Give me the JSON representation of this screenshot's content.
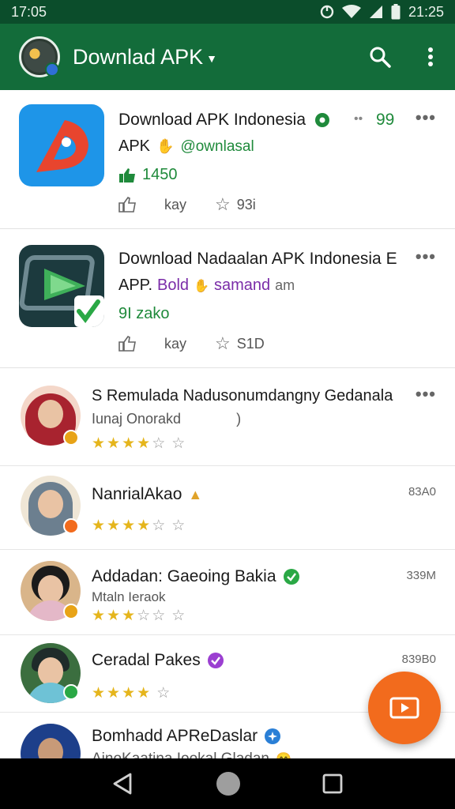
{
  "status_bar": {
    "time_left": "17:05",
    "time_right": "21:25"
  },
  "app_bar": {
    "title": "Downlad APK",
    "search_icon": "search-icon",
    "menu_icon": "more-vert-icon"
  },
  "apps": [
    {
      "title": "Download APK Indonesia",
      "badge_count": "99",
      "sub_prefix": "APK",
      "sub_tag": "@ownlasal",
      "downloads": "1450",
      "like_label": "kay",
      "rating_count": "93i"
    },
    {
      "title": "Download Nadaalan APK Indonesia E",
      "sub_prefix": "APP.",
      "sub_tag1": "Bold",
      "sub_tag2": "samand",
      "sub_tag3": "am",
      "downloads": "9I zako",
      "like_label": "kay",
      "rating_count": "S1D"
    }
  ],
  "reviews": [
    {
      "name": "S Remulada Nadusonumdangny Gedanala",
      "sub": "Iunaj Onorakd",
      "sub_extra": ")",
      "rating": 3.5,
      "side": "",
      "badge_color": "#e8a317",
      "hijab": "#a8232f"
    },
    {
      "name": "NanrialAkao",
      "sub": "",
      "rating": 3.5,
      "side": "83A0",
      "badge_color": "#f26b1d",
      "hijab": "#6c7f8f"
    },
    {
      "name": "Addadan: Gaeoing Bakia",
      "sub": "Mtaln Ieraok",
      "rating": 3,
      "side": "339M",
      "badge_color": "#e8a317",
      "hijab": "#1b1b1b"
    },
    {
      "name": "Ceradal Pakes",
      "sub": "",
      "rating": 4,
      "side": "839B0",
      "badge_color": "#2aa845",
      "hijab": "#1f4f3a"
    },
    {
      "name": "Bomhadd APReDaslar",
      "sub": "AinoKaatina Iookal Gladan",
      "rating": 0,
      "side": "",
      "badge_color": "#2a7fd6",
      "hijab": "#1d3f8a"
    }
  ],
  "colors": {
    "appbar": "#136c3a",
    "statusbar": "#0b4d2b",
    "fab": "#f26b1d",
    "star": "#e5b51c"
  }
}
